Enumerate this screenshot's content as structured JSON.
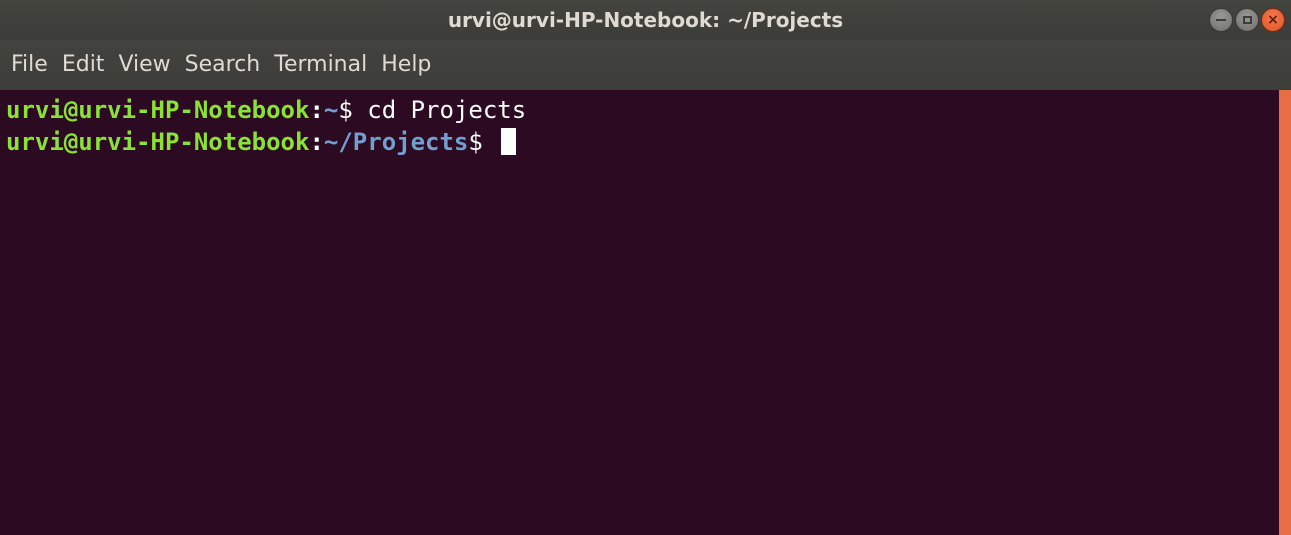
{
  "window": {
    "title": "urvi@urvi-HP-Notebook: ~/Projects"
  },
  "menu": [
    {
      "label": "File"
    },
    {
      "label": "Edit"
    },
    {
      "label": "View"
    },
    {
      "label": "Search"
    },
    {
      "label": "Terminal"
    },
    {
      "label": "Help"
    }
  ],
  "terminal": {
    "lines": [
      {
        "user": "urvi@urvi-HP-Notebook",
        "sep": ":",
        "path": "~",
        "prompt": "$",
        "command": " cd Projects"
      },
      {
        "user": "urvi@urvi-HP-Notebook",
        "sep": ":",
        "path": "~/Projects",
        "prompt": "$",
        "command": " "
      }
    ]
  },
  "colors": {
    "terminal_bg": "#2c0b22",
    "user": "#8ae234",
    "path": "#729fcf",
    "scrollbar": "#e86d44",
    "close_button": "#e0552a"
  },
  "icons": {
    "minimize": "minimize-icon",
    "maximize": "maximize-icon",
    "close": "close-icon"
  }
}
